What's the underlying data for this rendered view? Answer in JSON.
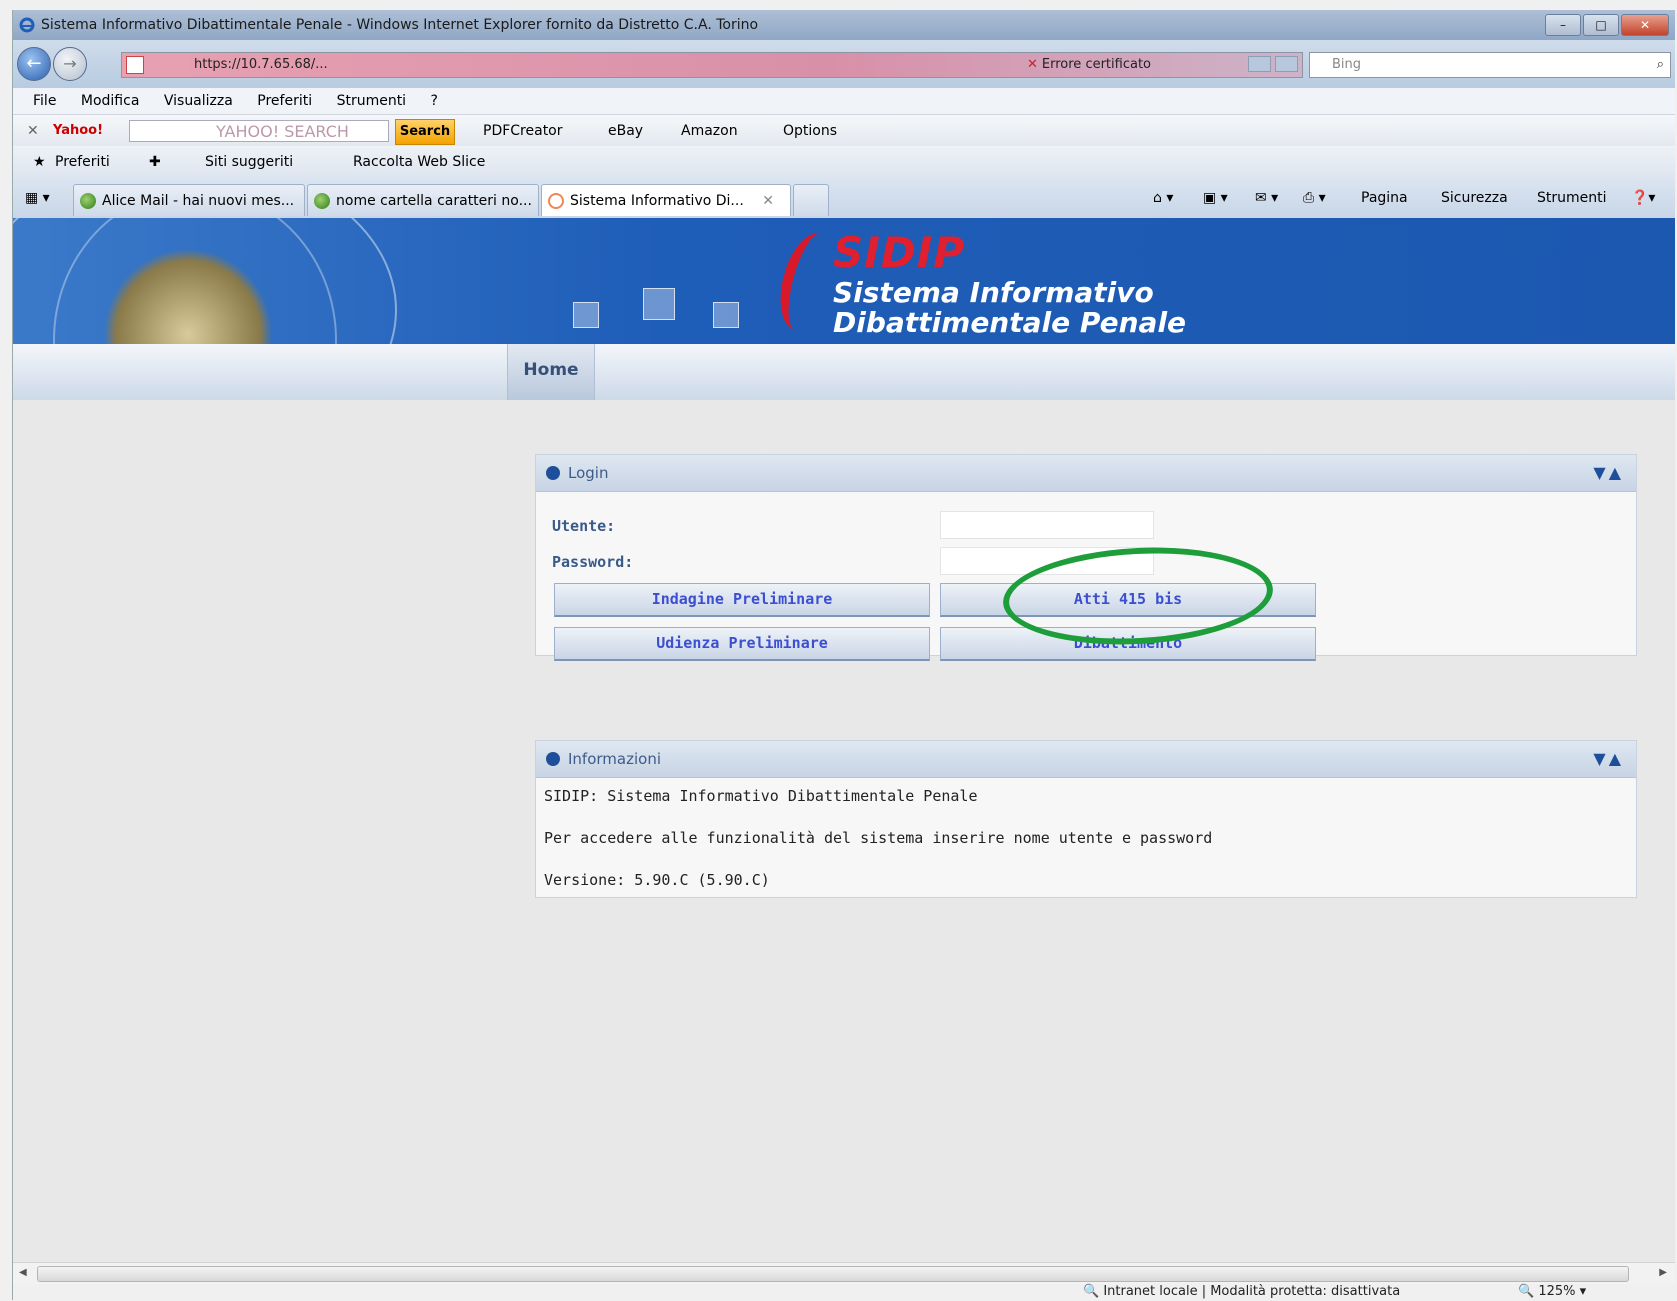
{
  "window": {
    "title": "Sistema Informativo Dibattimentale Penale - Windows Internet Explorer fornito da Distretto C.A. Torino"
  },
  "addressbar": {
    "url": "https://10.7.65.68/...",
    "cert_error": "Errore certificato",
    "search_placeholder": "Bing"
  },
  "menu": [
    "File",
    "Modifica",
    "Visualizza",
    "Preferiti",
    "Strumenti",
    "?"
  ],
  "yahoo_toolbar": {
    "logo": "Yahoo!",
    "search_box": "YAHOO! SEARCH",
    "search_button": "Search",
    "items": [
      "PDFCreator",
      "eBay",
      "Amazon",
      "Options"
    ]
  },
  "favorites_bar": {
    "favorites": "Preferiti",
    "items": [
      "Siti suggeriti",
      "Raccolta Web Slice"
    ]
  },
  "tabs": [
    {
      "label": "Alice Mail - hai nuovi mes..."
    },
    {
      "label": "nome cartella caratteri no..."
    },
    {
      "label": "Sistema Informativo Di..."
    }
  ],
  "command_bar": [
    "Pagina",
    "Sicurezza",
    "Strumenti"
  ],
  "banner": {
    "logo": "SIDIP",
    "line1": "Sistema Informativo",
    "line2": "Dibattimentale Penale"
  },
  "nav": {
    "home": "Home"
  },
  "login_panel": {
    "title": "Login",
    "user_label": "Utente:",
    "password_label": "Password:",
    "user_value": "",
    "password_value": "",
    "buttons": {
      "indagine": "Indagine Preliminare",
      "atti": "Atti 415 bis",
      "udienza": "Udienza Preliminare",
      "dibattimento": "Dibattimento"
    }
  },
  "info_panel": {
    "title": "Informazioni",
    "line1": "SIDIP: Sistema Informativo Dibattimentale Penale",
    "line2": "Per accedere alle funzionalità del sistema inserire nome utente e password",
    "line3": "Versione: 5.90.C (5.90.C)"
  },
  "statusbar": {
    "zone": "Intranet locale | Modalità protetta: disattivata",
    "zoom": "125%"
  },
  "colors": {
    "banner_blue": "#1e5db8",
    "sidip_red": "#e01f2f",
    "highlight_circle": "#1e9e3a",
    "button_text": "#3c4fd0"
  }
}
